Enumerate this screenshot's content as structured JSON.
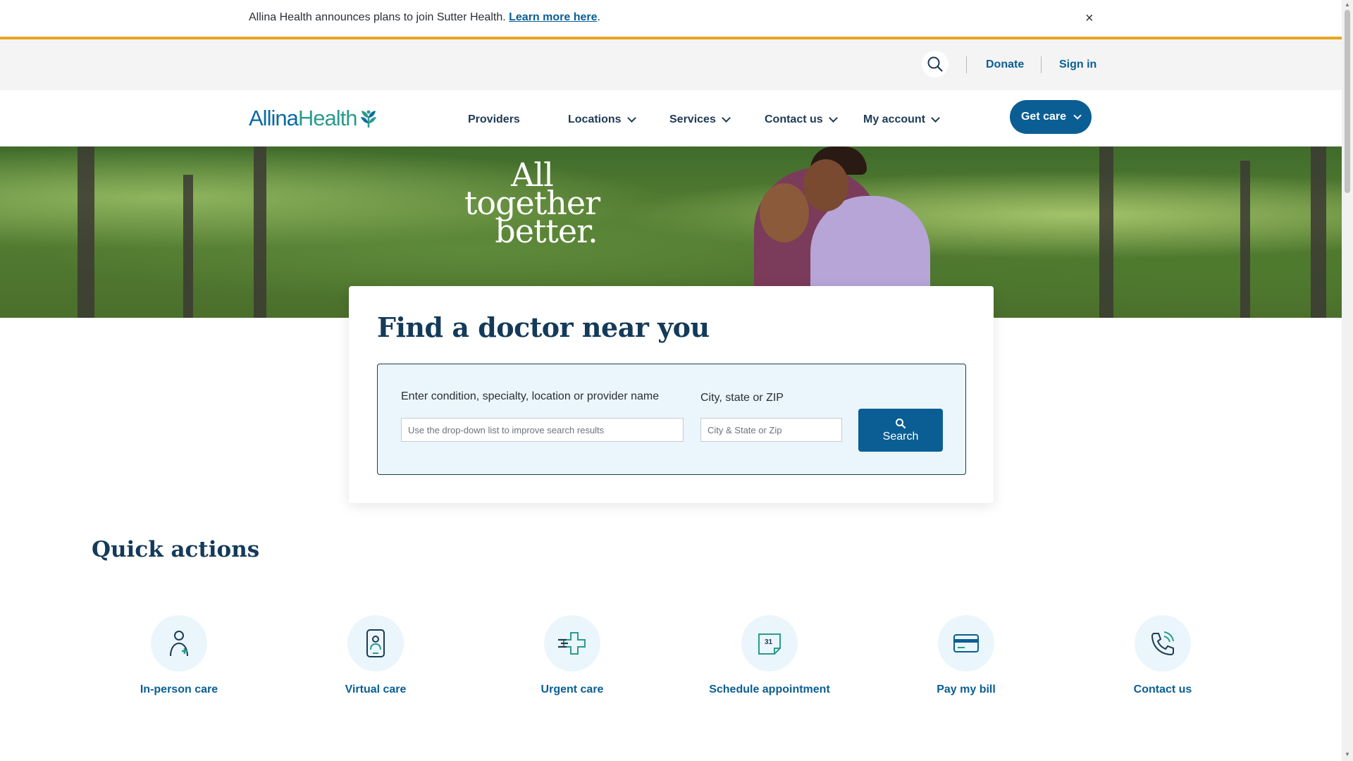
{
  "announcement": {
    "text": "Allina Health announces plans to join Sutter Health.",
    "link_label": "Learn more here",
    "suffix": ".",
    "close_label": "×"
  },
  "utility": {
    "search_icon": "search-icon",
    "donate_label": "Donate",
    "signin_label": "Sign in"
  },
  "brand": {
    "logo_part1": "Allina",
    "logo_part2": "Health",
    "logo_icon": "wheat-leaf-icon",
    "primary_color": "#0a5e94",
    "accent_color": "#e8a51c",
    "teal_color": "#2b9b8e"
  },
  "nav": {
    "items": [
      {
        "label": "Providers"
      },
      {
        "label": "Locations"
      },
      {
        "label": "Services"
      },
      {
        "label": "Contact us"
      },
      {
        "label": "My account"
      }
    ],
    "get_care_label": "Get care"
  },
  "hero": {
    "tagline_line1": "All",
    "tagline_line2": "together",
    "tagline_line3": "better."
  },
  "finder": {
    "title": "Find a doctor near you",
    "condition_label": "Enter condition, specialty, location or provider name",
    "condition_placeholder": "Use the drop-down list to improve search results",
    "location_label": "City, state or ZIP",
    "location_placeholder": "City & State or Zip",
    "search_label": "Search"
  },
  "quick_actions": {
    "title": "Quick actions",
    "items": [
      {
        "label": "In-person care",
        "icon": "person-plus-icon"
      },
      {
        "label": "Virtual care",
        "icon": "phone-person-icon"
      },
      {
        "label": "Urgent care",
        "icon": "medical-cross-icon"
      },
      {
        "label": "Schedule appointment",
        "icon": "calendar-icon"
      },
      {
        "label": "Pay my bill",
        "icon": "credit-card-icon"
      },
      {
        "label": "Contact us",
        "icon": "phone-call-icon"
      }
    ]
  }
}
